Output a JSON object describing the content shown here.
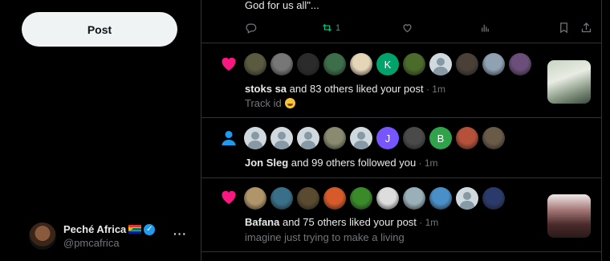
{
  "sidebar": {
    "post_button": "Post",
    "account": {
      "display_name": "Peché Africa",
      "handle": "@pmcafrica",
      "more": "···"
    }
  },
  "tweet": {
    "text_tail": "God for us all\"...",
    "retweet_count": "1"
  },
  "notifications": [
    {
      "type": "like",
      "actor": "stoks sa",
      "message": " and 83 others liked your post",
      "time": " · 1m",
      "subtext": "Track id",
      "avatars": [
        "#5a5a40",
        "#777",
        "#2b2b2b",
        "#3c6e4a",
        "#e6d6b8",
        "letter:K:#00a36c",
        "#4b6b2a",
        "default",
        "#4a4038",
        "#8fa1b3",
        "#6b4e7a"
      ]
    },
    {
      "type": "follow",
      "actor": "Jon Sleg",
      "message": " and 99 others followed you",
      "time": " · 1m",
      "avatars": [
        "default",
        "default",
        "default",
        "#8a8a70",
        "default",
        "letter:J:#7856ff",
        "#4a4a4a",
        "letter:B:#31a24c",
        "#b5503a",
        "#6a5a48"
      ]
    },
    {
      "type": "like",
      "actor": "Bafana",
      "message": " and 75 others liked your post",
      "time": " · 1m",
      "subtext": "imagine just trying to make a living",
      "avatars": [
        "#b0956a",
        "#3a6f8a",
        "#5a4a30",
        "#d65a2a",
        "#3a8a2a",
        "#dddddd",
        "#9ab0b8",
        "#4a90c8",
        "default",
        "#2a3a6a"
      ]
    }
  ],
  "colors": {
    "like": "#f91880",
    "follow": "#1d9bf0",
    "retweet": "#00ba7c",
    "muted": "#71767b",
    "border": "#2f3336"
  }
}
